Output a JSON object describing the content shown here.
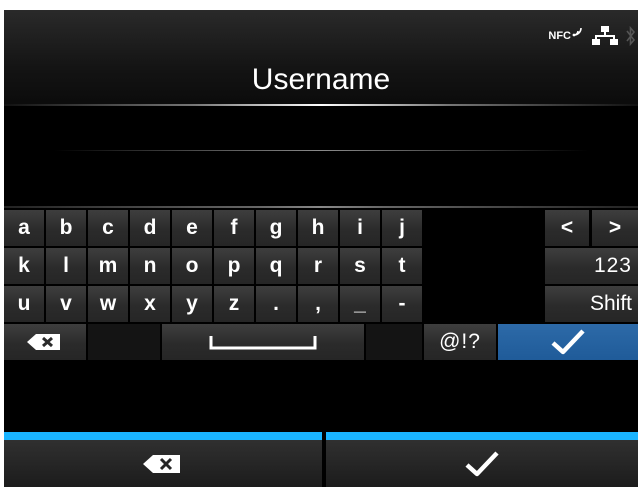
{
  "header": {
    "title": "Username",
    "status": {
      "nfc_label": "NFC"
    }
  },
  "input": {
    "value": ""
  },
  "keyboard": {
    "row1": [
      "a",
      "b",
      "c",
      "d",
      "e",
      "f",
      "g",
      "h",
      "i",
      "j",
      "<",
      ">"
    ],
    "row2": [
      "k",
      "l",
      "m",
      "n",
      "o",
      "p",
      "q",
      "r",
      "s",
      "t"
    ],
    "row3": [
      "u",
      "v",
      "w",
      "x",
      "y",
      "z",
      ".",
      ",",
      "_",
      "-"
    ],
    "numbers_label": "123",
    "shift_label": "Shift",
    "symbols_label": "@!?",
    "enter_color": "#1f5b99"
  },
  "bottom": {
    "accent_color": "#1ab4ff"
  }
}
